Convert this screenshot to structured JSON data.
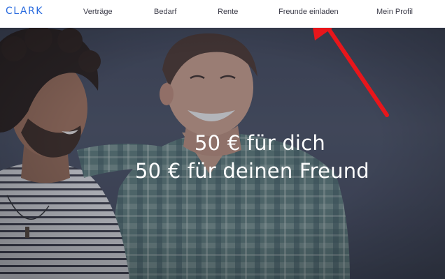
{
  "brand": {
    "logo_text": "CLARK",
    "color": "#2b6cdf"
  },
  "nav": {
    "items": [
      {
        "id": "vertraege",
        "label": "Verträge"
      },
      {
        "id": "bedarf",
        "label": "Bedarf"
      },
      {
        "id": "rente",
        "label": "Rente"
      },
      {
        "id": "freunde",
        "label": "Freunde einladen"
      },
      {
        "id": "profil",
        "label": "Mein Profil"
      }
    ]
  },
  "hero": {
    "line1": "50 € für dich",
    "line2": "50 € für deinen Freund"
  },
  "annotation": {
    "arrow_color": "#e8161b"
  }
}
